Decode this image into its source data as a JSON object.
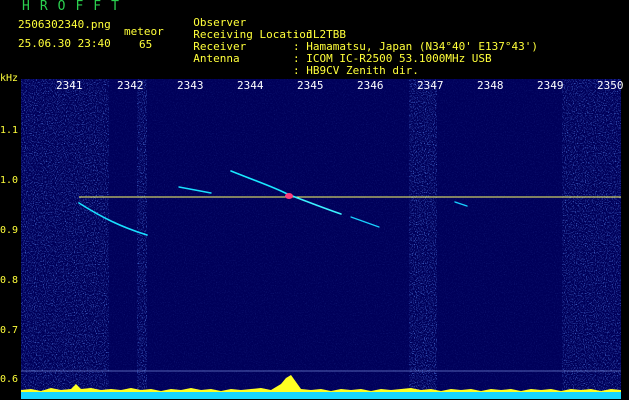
{
  "header": {
    "title": "HROFFT",
    "filename": "2506302340.png",
    "datetime": "25.06.30 23:40",
    "meteor_label": "meteor",
    "meteor_count": "65"
  },
  "observer_info": [
    {
      "label": "Observer",
      "value": ": JL2TBB"
    },
    {
      "label": "Receiving Location",
      "value": ": Hamamatsu, Japan (N34°40' E137°43')"
    },
    {
      "label": "Receiver",
      "value": ": ICOM IC-R2500 53.1000MHz USB"
    },
    {
      "label": "Antenna",
      "value": ": HB9CV Zenith dir."
    }
  ],
  "axes": {
    "y_unit": "kHz",
    "y_ticks": [
      "1.1",
      "1.0",
      "0.9",
      "0.8",
      "0.7",
      "0.6"
    ],
    "x_ticks": [
      "2341",
      "2342",
      "2343",
      "2344",
      "2345",
      "2346",
      "2347",
      "2348",
      "2349",
      "2350"
    ]
  },
  "colors": {
    "background": "#000000",
    "spectrogram_bg": "#00005a",
    "noise": "#1e3cff",
    "trace": "#00ffff",
    "reference_line": "#ffff66",
    "header_green": "#22c55e",
    "header_yellow": "#ffff3a"
  }
}
